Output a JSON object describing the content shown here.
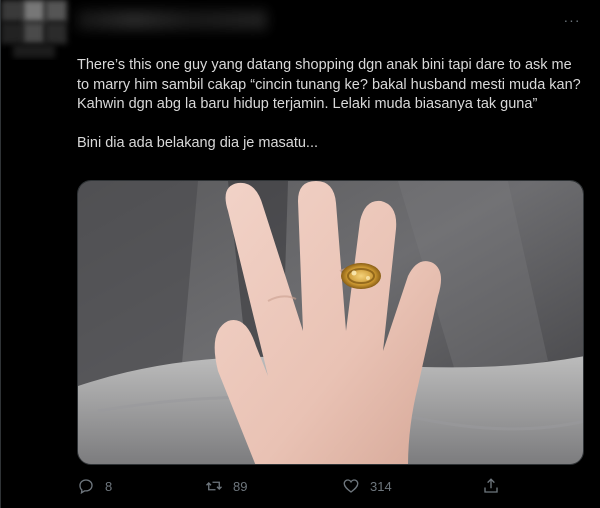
{
  "tweet": {
    "text": "There’s this one guy yang datang shopping dgn anak bini tapi dare to ask me to marry him sambil cakap “cincin tunang ke? bakal husband mesti muda kan? Kahwin dgn abg la baru hidup terjamin. Lelaki muda biasanya tak guna”\n\nBini dia ada belakang dia je masatu...",
    "more_label": "···"
  },
  "media": {
    "icon": "photo-of-hand-with-gold-ring"
  },
  "actions": {
    "reply": {
      "icon": "reply-icon",
      "count": "8"
    },
    "retweet": {
      "icon": "retweet-icon",
      "count": "89"
    },
    "like": {
      "icon": "heart-icon",
      "count": "314"
    },
    "share": {
      "icon": "share-icon"
    }
  },
  "colors": {
    "background": "#000000",
    "text": "#d9d9d9",
    "secondary": "#6e767d",
    "border": "#2f3336"
  }
}
